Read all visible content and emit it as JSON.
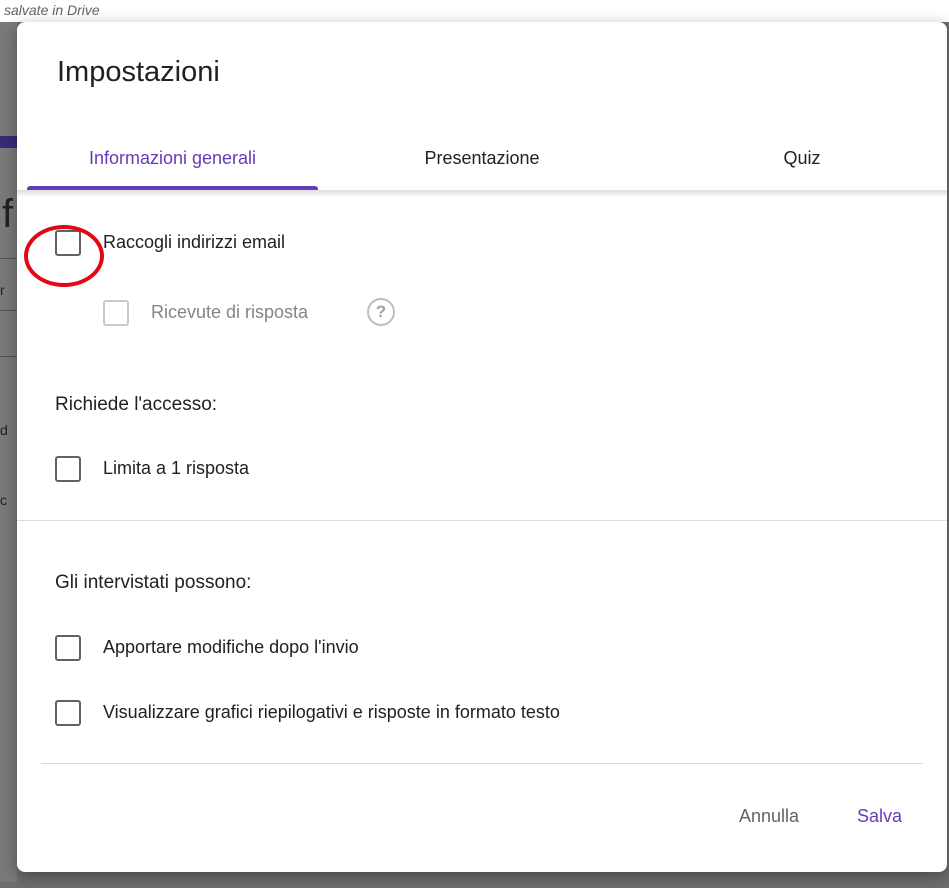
{
  "background": {
    "top_text": "salvate in Drive",
    "big_letter": "f",
    "side_chars": [
      "r",
      "d",
      "c"
    ]
  },
  "dialog": {
    "title": "Impostazioni",
    "tabs": [
      {
        "label": "Informazioni generali",
        "active": true
      },
      {
        "label": "Presentazione",
        "active": false
      },
      {
        "label": "Quiz",
        "active": false
      }
    ],
    "collect_email": {
      "label": "Raccogli indirizzi email",
      "checked": false
    },
    "response_receipts": {
      "label": "Ricevute di risposta",
      "checked": false,
      "disabled": true,
      "help_icon": "help-circle-icon"
    },
    "requires_login": {
      "heading": "Richiede l'accesso:",
      "limit_one": {
        "label": "Limita a 1 risposta",
        "checked": false
      }
    },
    "respondents_can": {
      "heading": "Gli intervistati possono:",
      "edit_after": {
        "label": "Apportare modifiche dopo l'invio",
        "checked": false
      },
      "see_summary": {
        "label": "Visualizzare grafici riepilogativi e risposte in formato testo",
        "checked": false
      }
    },
    "actions": {
      "cancel": "Annulla",
      "save": "Salva"
    },
    "colors": {
      "accent": "#673ab7",
      "highlight": "#e30613"
    }
  }
}
